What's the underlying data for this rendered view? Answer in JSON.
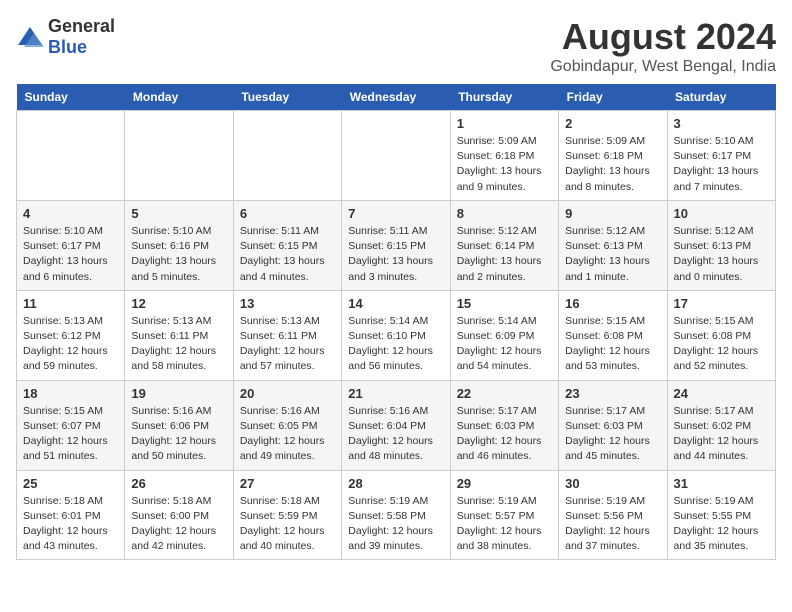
{
  "logo": {
    "general": "General",
    "blue": "Blue"
  },
  "title": "August 2024",
  "subtitle": "Gobindapur, West Bengal, India",
  "days_of_week": [
    "Sunday",
    "Monday",
    "Tuesday",
    "Wednesday",
    "Thursday",
    "Friday",
    "Saturday"
  ],
  "weeks": [
    [
      {
        "date": "",
        "info": ""
      },
      {
        "date": "",
        "info": ""
      },
      {
        "date": "",
        "info": ""
      },
      {
        "date": "",
        "info": ""
      },
      {
        "date": "1",
        "info": "Sunrise: 5:09 AM\nSunset: 6:18 PM\nDaylight: 13 hours\nand 9 minutes."
      },
      {
        "date": "2",
        "info": "Sunrise: 5:09 AM\nSunset: 6:18 PM\nDaylight: 13 hours\nand 8 minutes."
      },
      {
        "date": "3",
        "info": "Sunrise: 5:10 AM\nSunset: 6:17 PM\nDaylight: 13 hours\nand 7 minutes."
      }
    ],
    [
      {
        "date": "4",
        "info": "Sunrise: 5:10 AM\nSunset: 6:17 PM\nDaylight: 13 hours\nand 6 minutes."
      },
      {
        "date": "5",
        "info": "Sunrise: 5:10 AM\nSunset: 6:16 PM\nDaylight: 13 hours\nand 5 minutes."
      },
      {
        "date": "6",
        "info": "Sunrise: 5:11 AM\nSunset: 6:15 PM\nDaylight: 13 hours\nand 4 minutes."
      },
      {
        "date": "7",
        "info": "Sunrise: 5:11 AM\nSunset: 6:15 PM\nDaylight: 13 hours\nand 3 minutes."
      },
      {
        "date": "8",
        "info": "Sunrise: 5:12 AM\nSunset: 6:14 PM\nDaylight: 13 hours\nand 2 minutes."
      },
      {
        "date": "9",
        "info": "Sunrise: 5:12 AM\nSunset: 6:13 PM\nDaylight: 13 hours\nand 1 minute."
      },
      {
        "date": "10",
        "info": "Sunrise: 5:12 AM\nSunset: 6:13 PM\nDaylight: 13 hours\nand 0 minutes."
      }
    ],
    [
      {
        "date": "11",
        "info": "Sunrise: 5:13 AM\nSunset: 6:12 PM\nDaylight: 12 hours\nand 59 minutes."
      },
      {
        "date": "12",
        "info": "Sunrise: 5:13 AM\nSunset: 6:11 PM\nDaylight: 12 hours\nand 58 minutes."
      },
      {
        "date": "13",
        "info": "Sunrise: 5:13 AM\nSunset: 6:11 PM\nDaylight: 12 hours\nand 57 minutes."
      },
      {
        "date": "14",
        "info": "Sunrise: 5:14 AM\nSunset: 6:10 PM\nDaylight: 12 hours\nand 56 minutes."
      },
      {
        "date": "15",
        "info": "Sunrise: 5:14 AM\nSunset: 6:09 PM\nDaylight: 12 hours\nand 54 minutes."
      },
      {
        "date": "16",
        "info": "Sunrise: 5:15 AM\nSunset: 6:08 PM\nDaylight: 12 hours\nand 53 minutes."
      },
      {
        "date": "17",
        "info": "Sunrise: 5:15 AM\nSunset: 6:08 PM\nDaylight: 12 hours\nand 52 minutes."
      }
    ],
    [
      {
        "date": "18",
        "info": "Sunrise: 5:15 AM\nSunset: 6:07 PM\nDaylight: 12 hours\nand 51 minutes."
      },
      {
        "date": "19",
        "info": "Sunrise: 5:16 AM\nSunset: 6:06 PM\nDaylight: 12 hours\nand 50 minutes."
      },
      {
        "date": "20",
        "info": "Sunrise: 5:16 AM\nSunset: 6:05 PM\nDaylight: 12 hours\nand 49 minutes."
      },
      {
        "date": "21",
        "info": "Sunrise: 5:16 AM\nSunset: 6:04 PM\nDaylight: 12 hours\nand 48 minutes."
      },
      {
        "date": "22",
        "info": "Sunrise: 5:17 AM\nSunset: 6:03 PM\nDaylight: 12 hours\nand 46 minutes."
      },
      {
        "date": "23",
        "info": "Sunrise: 5:17 AM\nSunset: 6:03 PM\nDaylight: 12 hours\nand 45 minutes."
      },
      {
        "date": "24",
        "info": "Sunrise: 5:17 AM\nSunset: 6:02 PM\nDaylight: 12 hours\nand 44 minutes."
      }
    ],
    [
      {
        "date": "25",
        "info": "Sunrise: 5:18 AM\nSunset: 6:01 PM\nDaylight: 12 hours\nand 43 minutes."
      },
      {
        "date": "26",
        "info": "Sunrise: 5:18 AM\nSunset: 6:00 PM\nDaylight: 12 hours\nand 42 minutes."
      },
      {
        "date": "27",
        "info": "Sunrise: 5:18 AM\nSunset: 5:59 PM\nDaylight: 12 hours\nand 40 minutes."
      },
      {
        "date": "28",
        "info": "Sunrise: 5:19 AM\nSunset: 5:58 PM\nDaylight: 12 hours\nand 39 minutes."
      },
      {
        "date": "29",
        "info": "Sunrise: 5:19 AM\nSunset: 5:57 PM\nDaylight: 12 hours\nand 38 minutes."
      },
      {
        "date": "30",
        "info": "Sunrise: 5:19 AM\nSunset: 5:56 PM\nDaylight: 12 hours\nand 37 minutes."
      },
      {
        "date": "31",
        "info": "Sunrise: 5:19 AM\nSunset: 5:55 PM\nDaylight: 12 hours\nand 35 minutes."
      }
    ]
  ]
}
